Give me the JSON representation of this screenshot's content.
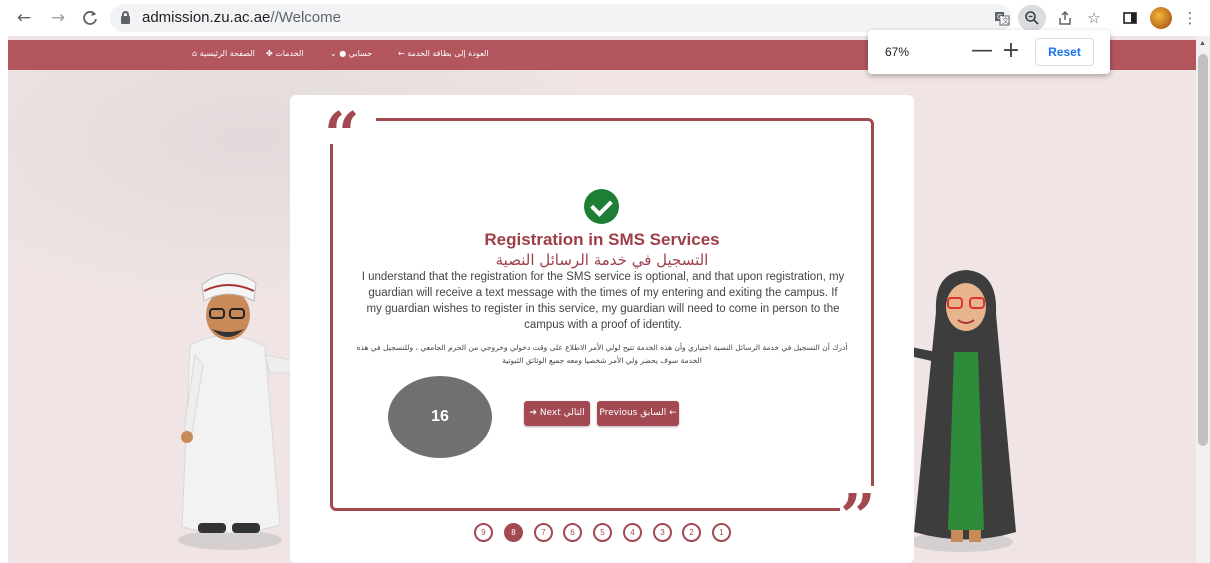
{
  "browser": {
    "back_icon": "←",
    "forward_icon": "→",
    "reload_icon": "C",
    "url_host": "admission.zu.ac.ae",
    "url_path": "//Welcome",
    "icons": [
      "translate-icon",
      "zoom-icon",
      "share-icon",
      "bookmark-star-icon",
      "side-panel-icon",
      "profile-avatar",
      "menu-icon"
    ]
  },
  "zoom_popup": {
    "level": "67%",
    "minus": "—",
    "plus": "+",
    "reset": "Reset"
  },
  "topnav": {
    "back_to_card": "العودة إلى بطاقة الخدمة",
    "my_account": "حسابي",
    "services": "الخدمات",
    "home": "الصفحة الرئيسية"
  },
  "content": {
    "title": "Registration in SMS Services",
    "title_ar": "التسجيل في خدمة الرسائل النصية",
    "body_en": "I understand that the registration for the SMS service is optional, and that upon registration, my guardian will receive a text message with the times of my entering and exiting the campus. If my guardian wishes to register in this service, my guardian will need to come in person to the campus with a proof of identity.",
    "body_ar": "أدرك أن التسجيل في خدمة الرسائل النصية اختياري وأن هذه الخدمة تتيح لولي الأمر الاطلاع على وقت دخولي وخروجي من الحرم الجامعي ، وللتسجيل في هذه الخدمة سوف يحضر ولي الأمر شخصيا ومعه جميع الوثائق الثبوتية"
  },
  "buttons": {
    "next": "Next التالي",
    "previous": "Previous السابق"
  },
  "badge": "16",
  "pager": {
    "steps": [
      "9",
      "8",
      "7",
      "6",
      "5",
      "4",
      "3",
      "2",
      "1"
    ],
    "active": "8"
  },
  "colors": {
    "brand": "#a24952",
    "nav": "#b2555c",
    "page_bg": "#f0e4e4",
    "success": "#1e7e34"
  }
}
